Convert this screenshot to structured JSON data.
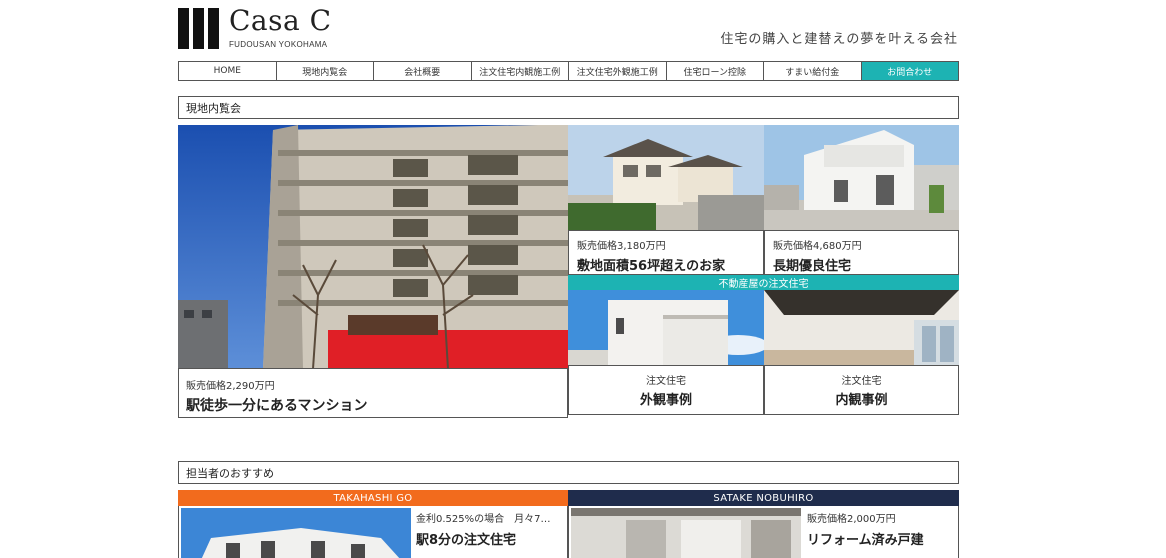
{
  "header": {
    "logo_name": "Casa C",
    "logo_sub": "FUDOUSAN YOKOHAMA",
    "tagline": "住宅の購入と建替えの夢を叶える会社"
  },
  "nav": [
    "HOME",
    "現地内覧会",
    "会社概要",
    "注文住宅内観施工例",
    "注文住宅外観施工例",
    "住宅ローン控除",
    "すまい給付金",
    "お問合わせ"
  ],
  "section1": {
    "title": "現地内覧会",
    "main_card": {
      "price": "販売価格2,290万円",
      "headline": "駅徒歩一分にあるマンション"
    },
    "card_a": {
      "price": "販売価格3,180万円",
      "headline": "敷地面積56坪超えのお家"
    },
    "card_b": {
      "price": "販売価格4,680万円",
      "headline": "長期優良住宅"
    },
    "band": "不動産屋の注文住宅",
    "card_c": {
      "category": "注文住宅",
      "headline": "外観事例"
    },
    "card_d": {
      "category": "注文住宅",
      "headline": "内観事例"
    }
  },
  "section2": {
    "title": "担当者のおすすめ",
    "staff": [
      {
        "name": "TAKAHASHI GO",
        "color": "#f26b1d",
        "line1": "金利0.525%の場合　月々7…",
        "line2": "駅8分の注文住宅"
      },
      {
        "name": "SATAKE NOBUHIRO",
        "color": "#1f2c4c",
        "line1": "販売価格2,000万円",
        "line2": "リフォーム済み戸建"
      }
    ]
  },
  "colors": {
    "accent": "#1db3b3",
    "border": "#555555"
  }
}
